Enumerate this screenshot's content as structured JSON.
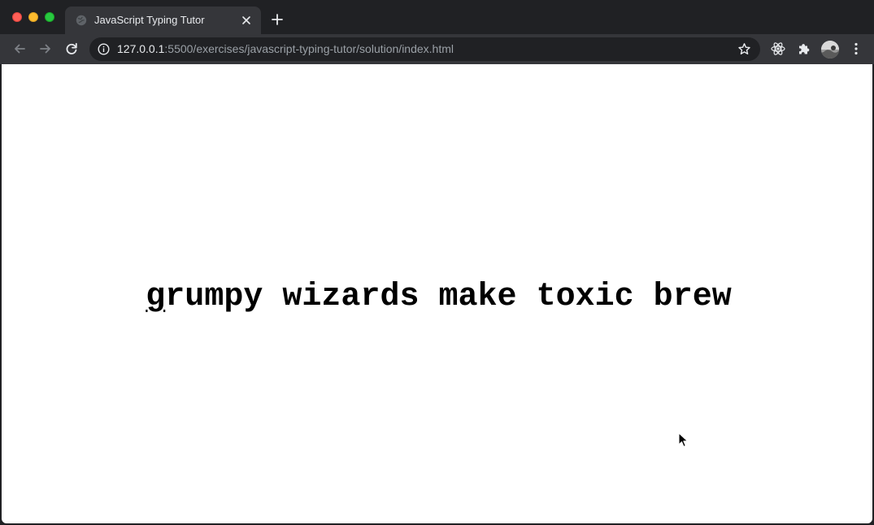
{
  "browser": {
    "tab": {
      "title": "JavaScript Typing Tutor",
      "favicon_icon": "globe-icon",
      "close_icon": "close-icon"
    },
    "new_tab_icon": "plus-icon",
    "toolbar": {
      "back_icon": "arrow-left-icon",
      "forward_icon": "arrow-right-icon",
      "reload_icon": "reload-icon",
      "info_icon": "info-circle-icon",
      "bookmark_icon": "star-icon",
      "extensions": [
        "react-icon",
        "puzzle-icon"
      ],
      "menu_icon": "kebab-menu-icon"
    },
    "address": {
      "host": "127.0.0.1",
      "rest": ":5500/exercises/javascript-typing-tutor/solution/index.html"
    }
  },
  "page": {
    "phrase": "grumpy wizards make toxic brew",
    "current_index": 0
  },
  "colors": {
    "chrome_dark": "#202124",
    "chrome_toolbar": "#35363a",
    "page_background": "#ffffff",
    "text": "#000000"
  }
}
